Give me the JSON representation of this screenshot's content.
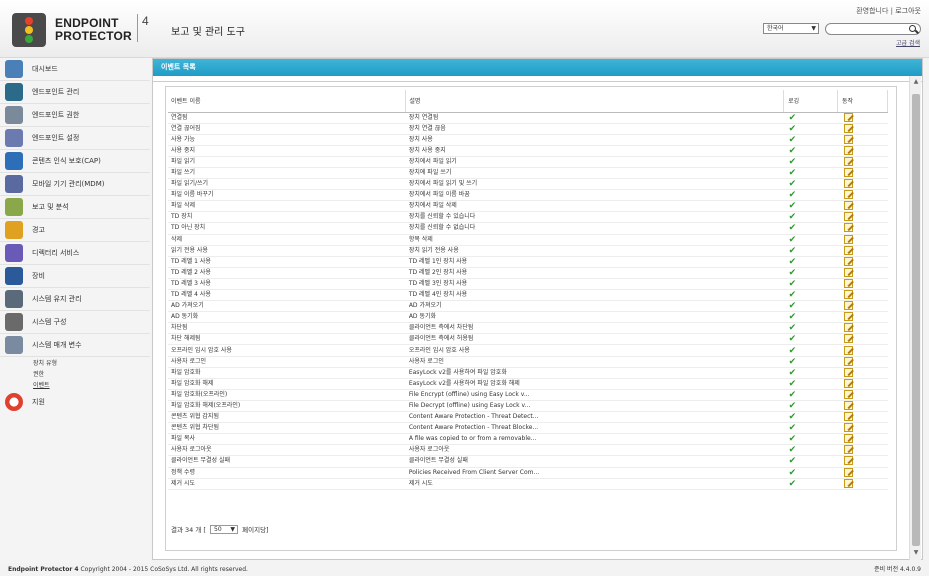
{
  "header": {
    "logo_line1": "ENDPOINT",
    "logo_line2": "PROTECTOR",
    "logo_version": "4",
    "app_title": "보고 및 관리 도구",
    "welcome_text": "환영합니다",
    "logout_label": "로그아웃",
    "language": "한국어",
    "search_placeholder": "",
    "advanced_search": "고급 검색"
  },
  "sidebar": {
    "items": [
      {
        "label": "대시보드",
        "icon": "dashboard-icon",
        "color": "#4a7fb8"
      },
      {
        "label": "엔드포인트 관리",
        "icon": "endpoint-management-icon",
        "color": "#2c6a8a"
      },
      {
        "label": "엔드포인트 권한",
        "icon": "endpoint-rights-icon",
        "color": "#7a8a9a"
      },
      {
        "label": "엔드포인트 설정",
        "icon": "endpoint-settings-icon",
        "color": "#6b7bb0"
      },
      {
        "label": "콘텐츠 인식 보호(CAP)",
        "icon": "content-aware-icon",
        "color": "#2c6fb8"
      },
      {
        "label": "모바일 기기 관리(MDM)",
        "icon": "mobile-device-icon",
        "color": "#5a6aa0"
      },
      {
        "label": "보고 및 분석",
        "icon": "reports-icon",
        "color": "#8aa84a"
      },
      {
        "label": "경고",
        "icon": "alerts-icon",
        "color": "#e0a020"
      },
      {
        "label": "디렉터리 서비스",
        "icon": "directory-services-icon",
        "color": "#6a5ab8"
      },
      {
        "label": "장비",
        "icon": "appliance-icon",
        "color": "#2a5a9a"
      },
      {
        "label": "시스템 유지 관리",
        "icon": "system-maintenance-icon",
        "color": "#5a6a7a"
      },
      {
        "label": "시스템 구성",
        "icon": "system-configuration-icon",
        "color": "#6a6a6a"
      },
      {
        "label": "시스템 매개 변수",
        "icon": "system-parameters-icon",
        "color": "#7a8aa0"
      }
    ],
    "sub_items": [
      "장치 유형",
      "권한",
      "이벤트"
    ],
    "support_label": "지원"
  },
  "panel": {
    "title": "이벤트 목록",
    "columns": [
      "이벤트 이름",
      "설명",
      "로깅",
      "동작"
    ],
    "rows": [
      [
        "연결됨",
        "장치 연결됨"
      ],
      [
        "연결 끊어짐",
        "장치 연결 끊음"
      ],
      [
        "사용 가능",
        "장치 사용"
      ],
      [
        "사용 중지",
        "장치 사용 중지"
      ],
      [
        "파일 읽기",
        "장치에서 파일 읽기"
      ],
      [
        "파일 쓰기",
        "장치에 파일 쓰기"
      ],
      [
        "파일 읽기/쓰기",
        "장치에서 파일 읽기 및 쓰기"
      ],
      [
        "파일 이름 바꾸기",
        "장치에서 파일 이름 바꿈"
      ],
      [
        "파일 삭제",
        "장치에서 파일 삭제"
      ],
      [
        "TD 장치",
        "장치를 신뢰할 수 있습니다"
      ],
      [
        "TD 아닌 장치",
        "장치를 신뢰할 수 없습니다"
      ],
      [
        "삭제",
        "항목 삭제"
      ],
      [
        "읽기 전용 사용",
        "장치 읽기 전용 사용"
      ],
      [
        "TD 레벨 1 사용",
        "TD 레벨 1인 장치 사용"
      ],
      [
        "TD 레벨 2 사용",
        "TD 레벨 2인 장치 사용"
      ],
      [
        "TD 레벨 3 사용",
        "TD 레벨 3인 장치 사용"
      ],
      [
        "TD 레벨 4 사용",
        "TD 레벨 4인 장치 사용"
      ],
      [
        "AD 가져오기",
        "AD 가져오기"
      ],
      [
        "AD 동기화",
        "AD 동기화"
      ],
      [
        "차단됨",
        "클라이언트 측에서 차단됨"
      ],
      [
        "차단 해제됨",
        "클라이언트 측에서 허용됨"
      ],
      [
        "오프라인 임시 암호 사용",
        "오프라인 임시 암호 사용"
      ],
      [
        "사용자 로그인",
        "사용자 로그인"
      ],
      [
        "파일 암호화",
        "EasyLock v2를 사용하여 파일 암호화"
      ],
      [
        "파일 암호화 해제",
        "EasyLock v2를 사용하여 파일 암호화 해제"
      ],
      [
        "파일 암호화(오프라인)",
        "File Encrypt (offline) using Easy Lock v..."
      ],
      [
        "파일 암호화 해제(오프라인)",
        "File Decrypt (offline) using Easy Lock v..."
      ],
      [
        "콘텐츠 위협 감지됨",
        "Content Aware Protection - Threat Detect..."
      ],
      [
        "콘텐츠 위협 차단됨",
        "Content Aware Protection - Threat Blocke..."
      ],
      [
        "파일 복사",
        "A file was copied to or from a removable..."
      ],
      [
        "사용자 로그아웃",
        "사용자 로그아웃"
      ],
      [
        "클라이언트 무결성 실패",
        "클라이언트 무결성 실패"
      ],
      [
        "정책 수령",
        "Policies Received From Client Server Com..."
      ],
      [
        "제거 시도",
        "제거 시도"
      ]
    ],
    "pager": {
      "results_prefix": "결과 34 개",
      "bracket_open": "[",
      "page_size": "50",
      "per_page_suffix": "페이지당]"
    }
  },
  "footer": {
    "copyright_brand": "Endpoint Protector 4",
    "copyright_rest": "Copyright 2004 - 2015 CoSoSys Ltd. All rights reserved.",
    "version_label": "준비",
    "version": "버전 4.4.0.9"
  }
}
